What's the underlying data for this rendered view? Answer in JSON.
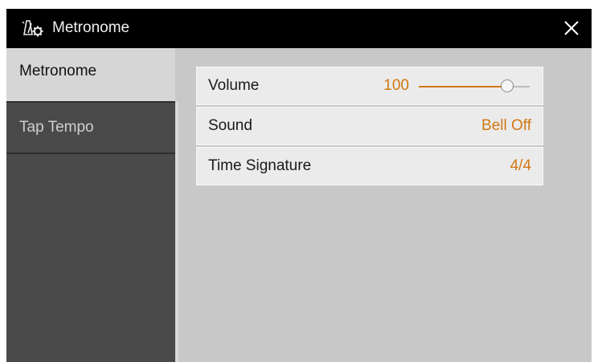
{
  "window": {
    "title": "Metronome",
    "title_icon": "metronome-settings-icon",
    "close_icon": "close-icon"
  },
  "sidebar": {
    "tabs": [
      {
        "label": "Metronome",
        "active": true
      },
      {
        "label": "Tap Tempo",
        "active": false
      }
    ]
  },
  "settings": [
    {
      "label": "Volume",
      "value": "100",
      "slider_fraction": 0.8
    },
    {
      "label": "Sound",
      "value": "Bell Off"
    },
    {
      "label": "Time Signature",
      "value": "4/4"
    }
  ],
  "colors": {
    "accent": "#d27814",
    "titlebar": "#000000",
    "sidebar": "#4a4a4a",
    "panel": "#c8c8c8"
  }
}
